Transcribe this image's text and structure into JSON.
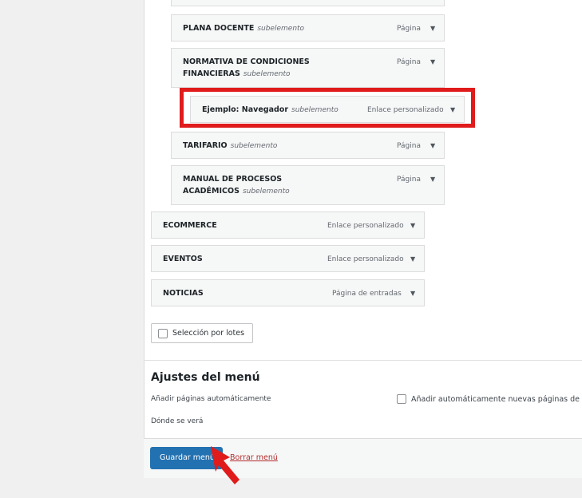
{
  "menu_items": [
    {
      "title": "PLANA DOCENTE",
      "sub": "subelemento",
      "type": "Página"
    },
    {
      "title_line1": "NORMATIVA DE CONDICIONES",
      "title_line2": "FINANCIERAS",
      "sub": "subelemento",
      "type": "Página"
    },
    {
      "title": "Ejemplo: Navegador",
      "sub": "subelemento",
      "type": "Enlace personalizado"
    },
    {
      "title": "TARIFARIO",
      "sub": "subelemento",
      "type": "Página"
    },
    {
      "title_line1": "MANUAL DE PROCESOS",
      "title_line2": "ACADÉMICOS",
      "sub": "subelemento",
      "type": "Página"
    },
    {
      "title": "ECOMMERCE",
      "type": "Enlace personalizado"
    },
    {
      "title": "EVENTOS",
      "type": "Enlace personalizado"
    },
    {
      "title": "NOTICIAS",
      "type": "Página de entradas"
    }
  ],
  "bulk_select_label": "Selección por lotes",
  "menu_settings": {
    "heading": "Ajustes del menú",
    "auto_add_label": "Añadir páginas automáticamente",
    "auto_add_option": "Añadir automáticamente nuevas páginas de n",
    "display_label": "Dónde se verá"
  },
  "footer": {
    "save_label": "Guardar menú",
    "delete_label": "Borrar menú"
  },
  "highlight_color": "#e01b1b",
  "accent_color": "#2271b1"
}
